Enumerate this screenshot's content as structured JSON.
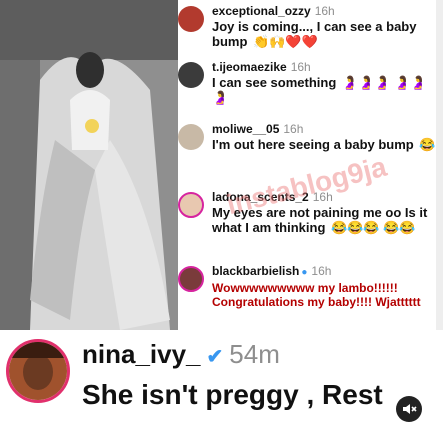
{
  "comments": [
    {
      "user": "exceptional_ozzy",
      "time": "16h",
      "text": "Joy is coming..., I can see a baby bump",
      "emojis": "👏🙌❤️❤️"
    },
    {
      "user": "t.ijeomaezike",
      "time": "16h",
      "text": "I can see something",
      "emojis": "🤰🤰🤰 🤰🤰🤰"
    },
    {
      "user": "moliwe__05",
      "time": "16h",
      "text": "I'm out here seeing a baby bump",
      "emojis": "😂"
    },
    {
      "user": "ladona_scents_2",
      "time": "16h",
      "text": "My eyes are not paining me oo Is it what I am thinking",
      "emojis": "😂😂😂 😂😂"
    },
    {
      "user": "blackbarbielish",
      "time": "16h",
      "verified": "●",
      "text": "Wowwwwwwwww my lambo!!!!!! Congratulations my baby!!!! Wjatttttt",
      "emojis": ""
    }
  ],
  "watermark": "instablog9ja",
  "post": {
    "user": "nina_ivy_",
    "verified": "✔",
    "time": "54m",
    "text": "She isn't preggy , Rest"
  },
  "colors": {
    "verified": "#3897f0",
    "red_text": "#b40000",
    "ring": "#e1306c"
  },
  "icons": {
    "mute": "speaker-muted-icon"
  }
}
